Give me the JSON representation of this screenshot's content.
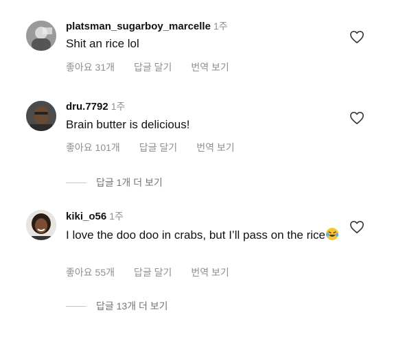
{
  "comments": [
    {
      "username": "platsman_sugarboy_marcelle",
      "time": "1주",
      "text": "Shit an rice lol",
      "likes": "좋아요 31개",
      "reply": "답글 달기",
      "translate": "번역 보기",
      "avatar_icon": "avatar-photo"
    },
    {
      "username": "dru.7792",
      "time": "1주",
      "text": "Brain butter is delicious!",
      "likes": "좋아요 101개",
      "reply": "답글 달기",
      "translate": "번역 보기",
      "view_replies": "답글 1개 더 보기",
      "avatar_icon": "avatar-photo"
    },
    {
      "username": "kiki_o56",
      "time": "1주",
      "text": "I love the doo doo in crabs, but I’ll pass on the rice",
      "likes": "좋아요 55개",
      "reply": "답글 달기",
      "translate": "번역 보기",
      "view_replies": "답글 13개 더 보기",
      "avatar_icon": "avatar-photo",
      "emoji": "laughing-tears-emoji"
    }
  ],
  "icons": {
    "like": "heart-outline-icon"
  },
  "colors": {
    "text": "#111111",
    "muted": "#8e8e8e",
    "background": "#ffffff"
  }
}
